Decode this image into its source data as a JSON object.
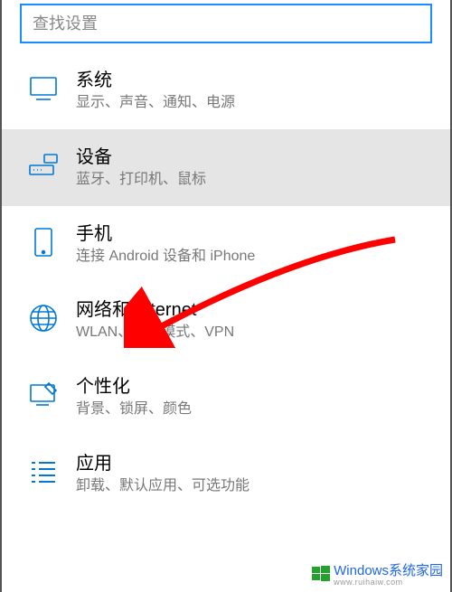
{
  "search": {
    "placeholder": "查找设置"
  },
  "items": [
    {
      "id": "system",
      "title": "系统",
      "sub": "显示、声音、通知、电源"
    },
    {
      "id": "devices",
      "title": "设备",
      "sub": "蓝牙、打印机、鼠标"
    },
    {
      "id": "phone",
      "title": "手机",
      "sub": "连接 Android 设备和 iPhone"
    },
    {
      "id": "network",
      "title": "网络和 Internet",
      "sub": "WLAN、飞行模式、VPN"
    },
    {
      "id": "personal",
      "title": "个性化",
      "sub": "背景、锁屏、颜色"
    },
    {
      "id": "apps",
      "title": "应用",
      "sub": "卸载、默认应用、可选功能"
    }
  ],
  "watermark": {
    "brand": "Windows系统家园",
    "url": "www.ruihaiw.com"
  }
}
